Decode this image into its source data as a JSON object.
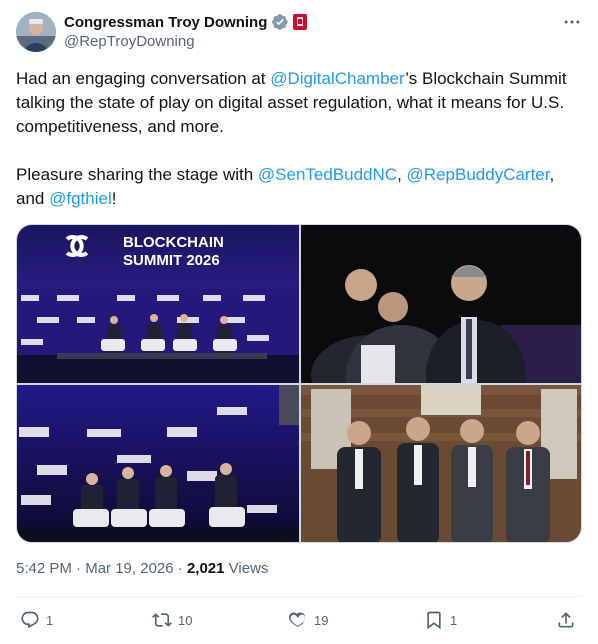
{
  "author": {
    "display_name": "Congressman Troy Downing",
    "handle": "@RepTroyDowning",
    "verified_color": "#829aab",
    "badge_color": "#c8102e"
  },
  "post": {
    "p1_before": "Had an engaging conversation at ",
    "p1_mention": "@DigitalChamber",
    "p1_after": "’s Blockchain Summit talking the state of play on digital asset regulation, what it means for U.S. competitiveness, and more.",
    "p2_before": "Pleasure sharing the stage with ",
    "p2_mention1": "@SenTedBuddNC",
    "p2_sep1": ", ",
    "p2_mention2": "@RepBuddyCarter",
    "p2_sep2": ", and ",
    "p2_mention3": "@fgthiel",
    "p2_after": "!"
  },
  "media": {
    "banner_line1": "BLOCKCHAIN",
    "banner_line2": "SUMMIT 2026"
  },
  "meta": {
    "time": "5:42 PM",
    "dot1": " · ",
    "date": "Mar 19, 2026",
    "dot2": " · ",
    "views": "2,021",
    "views_label": " Views"
  },
  "actions": {
    "replies": "1",
    "reposts": "10",
    "likes": "19",
    "bookmarks": "1"
  },
  "colors": {
    "link": "#1d9bf0",
    "secondary_text": "#536471",
    "text": "#0f1419"
  },
  "icons": [
    "verified-icon",
    "flag-badge-icon",
    "more-icon",
    "reply-icon",
    "retweet-icon",
    "like-icon",
    "bookmark-icon",
    "share-icon"
  ]
}
